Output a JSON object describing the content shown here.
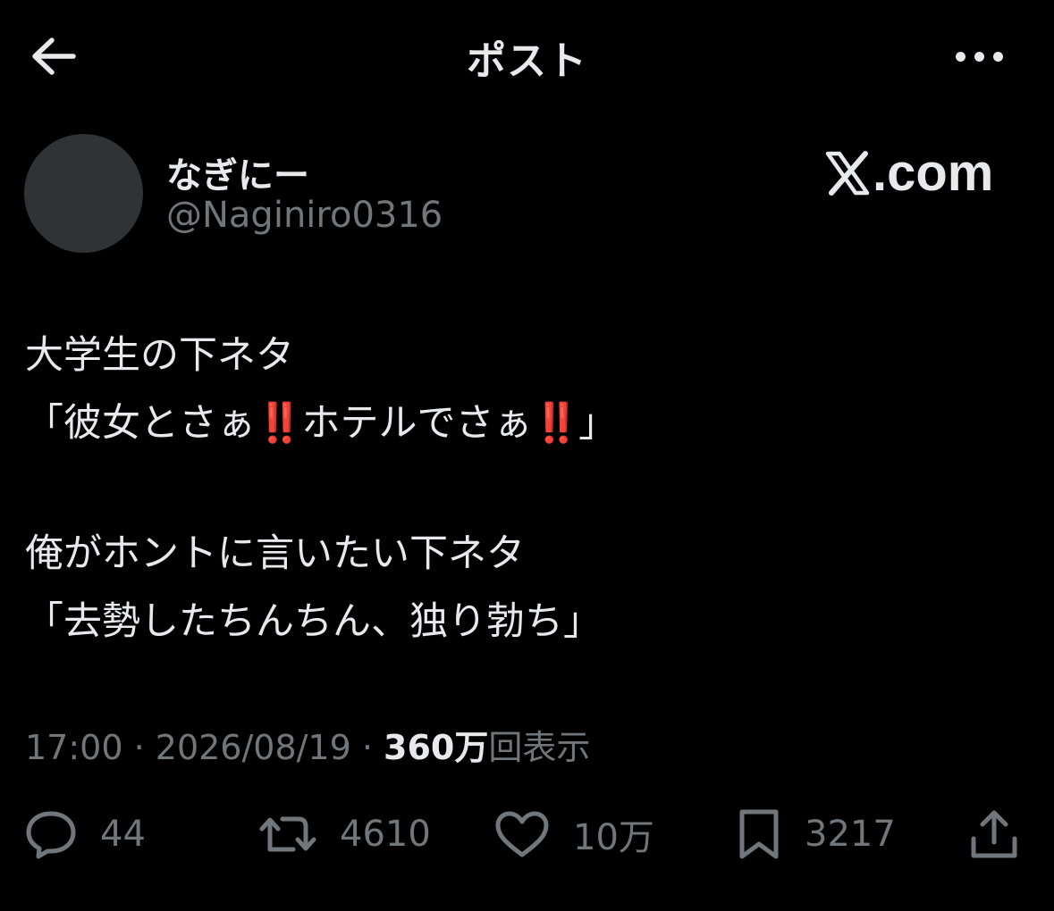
{
  "nav": {
    "title": "ポスト",
    "back_icon": "arrow-left-icon",
    "more_icon": "more-horizontal-icon"
  },
  "author": {
    "display_name": "なぎにー",
    "handle": "@Naginiro0316"
  },
  "brand": {
    "text": ".com",
    "logo_letter": "X"
  },
  "tweet": {
    "lines": [
      "大学生の下ネタ",
      "「彼女とさぁ",
      "‼️",
      "ホテルでさぁ",
      "‼️",
      "」",
      "俺がホントに言いたい下ネタ",
      "「去勢したちんちん、独り勃ち」"
    ]
  },
  "meta": {
    "time": "17:00",
    "sep1": " · ",
    "date": "2026/08/19",
    "sep2": " · ",
    "views_count": "360万",
    "views_label": "回表示"
  },
  "actions": {
    "reply": {
      "icon": "reply-bubble-icon",
      "count": "44"
    },
    "retweet": {
      "icon": "retweet-icon",
      "count": "4610"
    },
    "like": {
      "icon": "heart-icon",
      "count": "10万"
    },
    "bookmark": {
      "icon": "bookmark-icon",
      "count": "3217"
    },
    "share": {
      "icon": "share-upload-icon"
    }
  },
  "colors": {
    "background": "#000000",
    "text_primary": "#e7e9ea",
    "text_secondary": "#71767b",
    "avatar_placeholder": "#2f3336",
    "emoji_red": "#e0202c"
  }
}
